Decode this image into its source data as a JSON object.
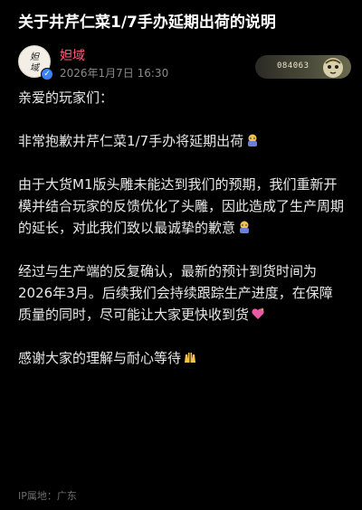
{
  "post": {
    "title": "关于井芹仁菜1/7手办延期出荷的说明",
    "author": "妲域",
    "avatar_text": "妲域",
    "time": "2026年1月7日 16:30",
    "badge_number": "084063",
    "ip_location": "IP属地：广东"
  },
  "body": {
    "greeting": "亲爱的玩家们：",
    "p1": "非常抱歉井芹仁菜1/7手办将延期出荷",
    "p2": "由于大货M1版头雕未能达到我们的预期，我们重新开模并结合玩家的反馈优化了头雕，因此造成了生产周期的延长，对此我们致以最诚挚的歉意",
    "p3": "经过与生产端的反复确认，最新的预计到货时间为2026年3月。后续我们会持续跟踪生产进度，在保障质量的同时，尽可能让大家更快收到货",
    "p4": "感谢大家的理解与耐心等待"
  },
  "icons": {
    "verify": "verified-badge-icon",
    "bow": "bowing-person-emoji",
    "heart": "sparkling-heart-emoji",
    "hands": "raising-hands-emoji"
  },
  "colors": {
    "background": "#000000",
    "author": "#ff5a7a",
    "text": "#e8e8e8",
    "meta": "#8a8a8a"
  }
}
